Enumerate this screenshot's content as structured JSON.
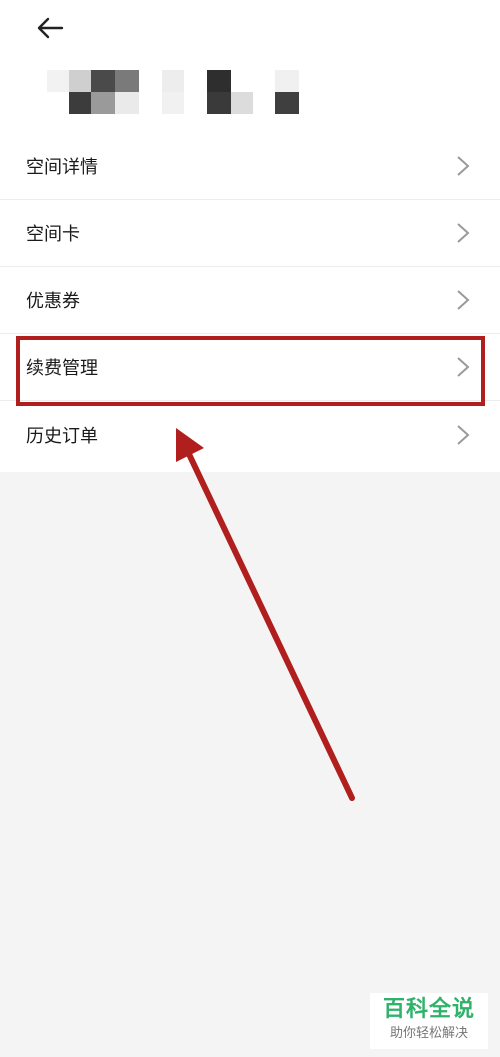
{
  "header": {
    "back_icon": "arrow-left-icon"
  },
  "menu": {
    "items": [
      {
        "label": "空间详情",
        "icon": "chevron-right-icon"
      },
      {
        "label": "空间卡",
        "icon": "chevron-right-icon"
      },
      {
        "label": "优惠券",
        "icon": "chevron-right-icon"
      },
      {
        "label": "续费管理",
        "icon": "chevron-right-icon"
      },
      {
        "label": "历史订单",
        "icon": "chevron-right-icon"
      }
    ]
  },
  "annotation": {
    "highlight_color": "#b01e1e"
  },
  "watermark": {
    "title": "百科全说",
    "subtitle": "助你轻松解决",
    "color": "#2fb26a"
  }
}
